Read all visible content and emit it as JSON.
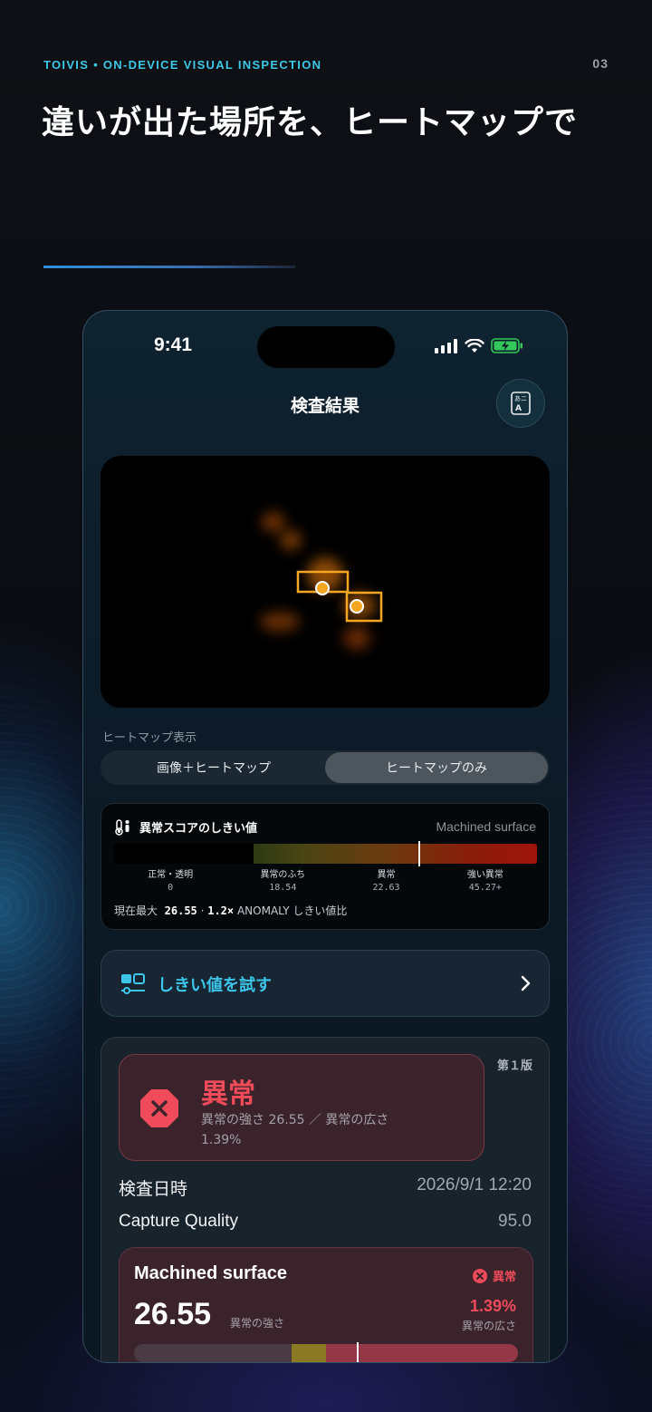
{
  "header": {
    "eyebrow": "TOIVIS  •  ON-DEVICE VISUAL INSPECTION",
    "page_number": "03",
    "headline": "違いが出た場所を、ヒートマップで"
  },
  "status_bar": {
    "time": "9:41"
  },
  "nav": {
    "title": "検査結果",
    "action_icon": "text-translate-icon"
  },
  "heatmap_view": {
    "label": "ヒートマップ表示",
    "options": [
      "画像＋ヒートマップ",
      "ヒートマップのみ"
    ],
    "selected": "ヒートマップのみ"
  },
  "threshold": {
    "title": "異常スコアのしきい値",
    "surface": "Machined surface",
    "ticks": [
      {
        "label": "正常・透明",
        "value": "0"
      },
      {
        "label": "異常のふち",
        "value": "18.54"
      },
      {
        "label": "異常",
        "value": "22.63"
      },
      {
        "label": "強い異常",
        "value": "45.27+"
      }
    ],
    "marker_fraction": 0.72,
    "footer_prefix": "現在最大",
    "footer_value": "26.55",
    "footer_ratio": "1.2×",
    "footer_suffix": "ANOMALY しきい値比"
  },
  "try_threshold": {
    "label": "しきい値を試す"
  },
  "result": {
    "edition": "第１版",
    "status": "異常",
    "summary": "異常の強さ 26.55 ／ 異常の広さ 1.39%",
    "inspected_at_label": "検査日時",
    "inspected_at": "2026/9/1 12:20",
    "capture_quality_label": "Capture Quality",
    "capture_quality": "95.0",
    "surface": {
      "name": "Machined surface",
      "badge": "異常",
      "score": "26.55",
      "score_label": "異常の強さ",
      "area": "1.39%",
      "area_label": "異常の広さ",
      "bar_segments": [
        0.41,
        0.09,
        0.5
      ],
      "marker_fraction": 0.58
    }
  },
  "colors": {
    "accent": "#3ec8e6",
    "danger": "#ef4b5a",
    "highlight": "#f5a623"
  }
}
